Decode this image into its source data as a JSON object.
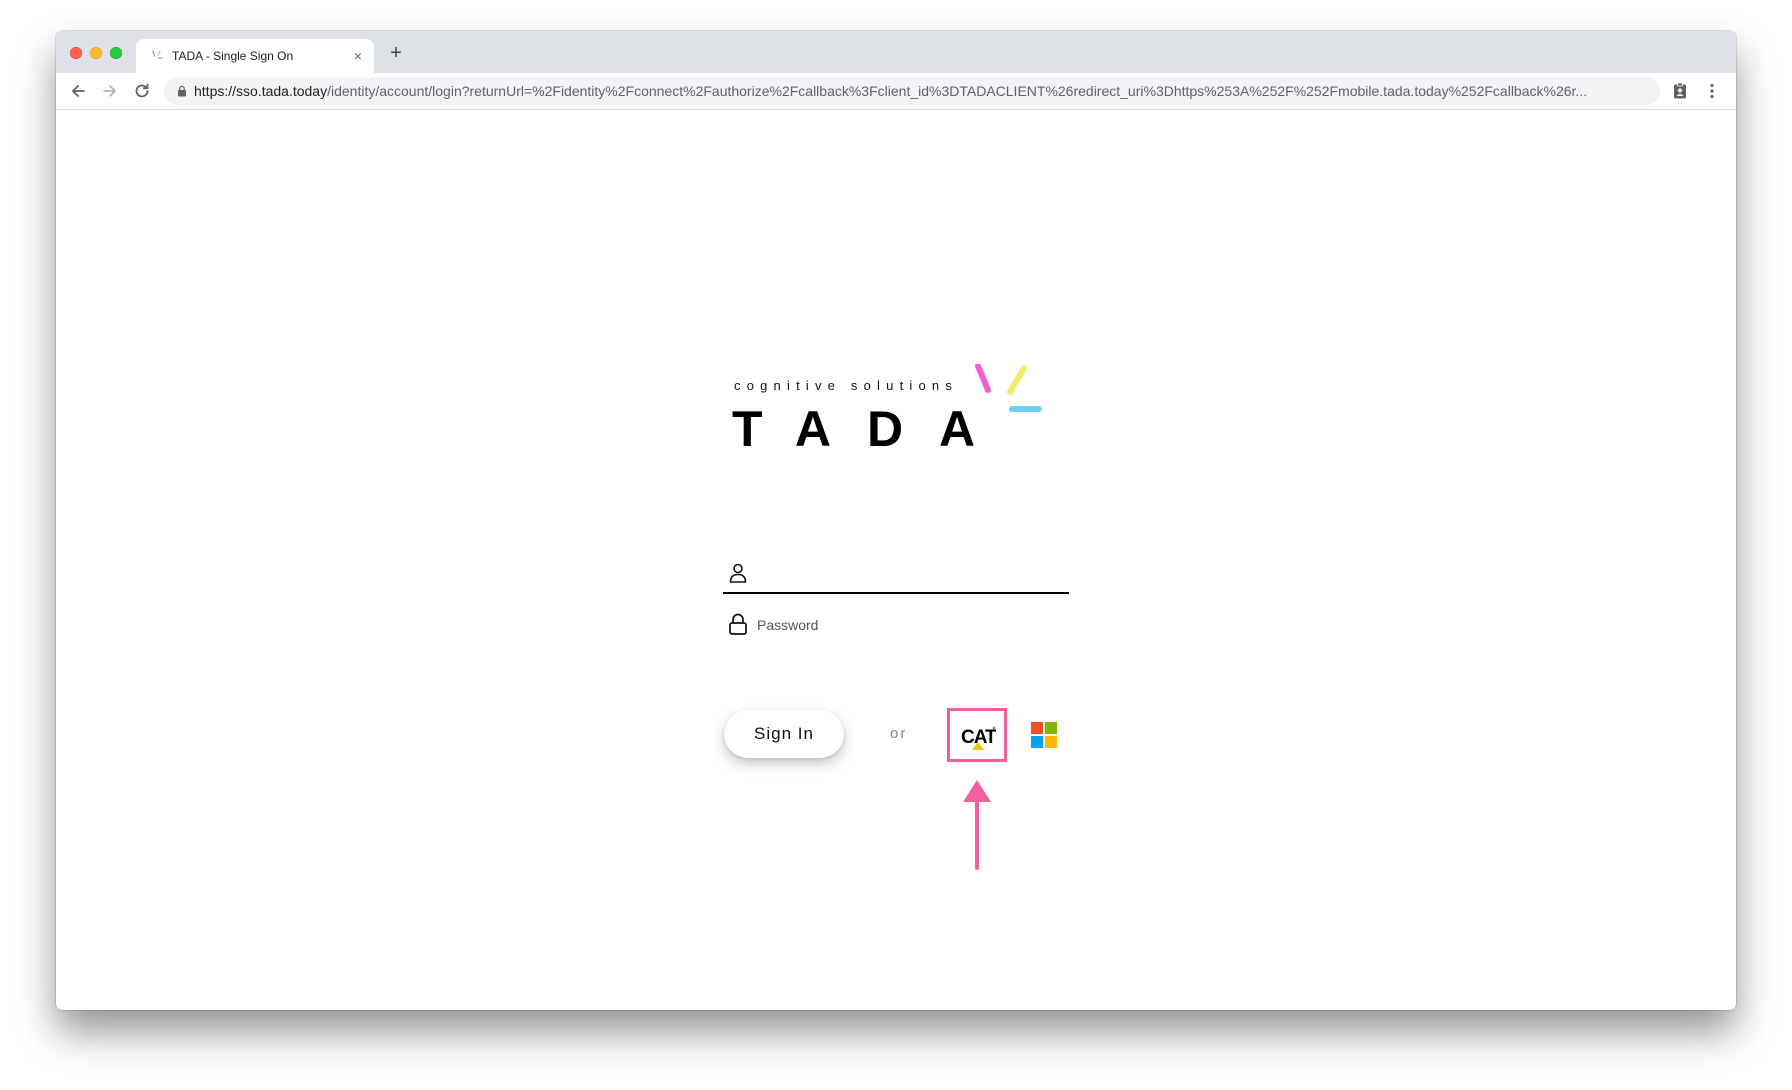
{
  "browser": {
    "tab_title": "TADA - Single Sign On",
    "tab_close_glyph": "×",
    "new_tab_glyph": "+",
    "url_host": "https://sso.tada.today",
    "url_path": "/identity/account/login?returnUrl=%2Fidentity%2Fconnect%2Fauthorize%2Fcallback%3Fclient_id%3DTADACLIENT%26redirect_uri%3Dhttps%253A%252F%252Fmobile.tada.today%252Fcallback%26r..."
  },
  "logo": {
    "tagline": "cognitive solutions",
    "wordmark": "TADA",
    "burst_colors": [
      "#f25fd0",
      "#f2ec6a",
      "#6fd0f5"
    ]
  },
  "form": {
    "username_value": "",
    "password_placeholder": "Password",
    "signin_label": "Sign In",
    "or_label": "or"
  },
  "providers": {
    "cat_label": "CAT",
    "highlight_color": "#f0609a",
    "microsoft_colors": [
      "#f25022",
      "#7fba00",
      "#00a4ef",
      "#ffb900"
    ]
  }
}
